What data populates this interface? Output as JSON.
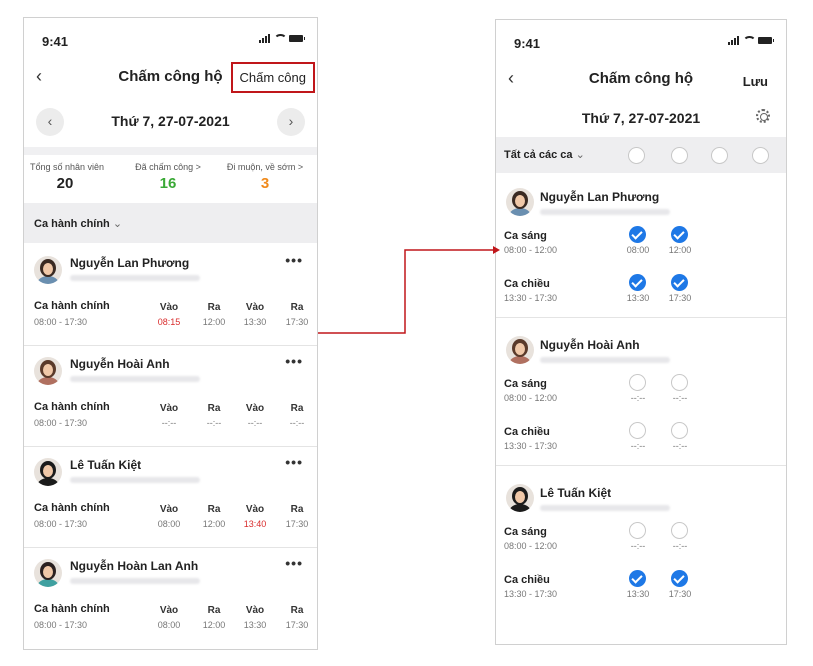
{
  "left": {
    "status_time": "9:41",
    "title": "Chấm công hộ",
    "action_button": "Chấm công",
    "date": "Thứ 7, 27-07-2021",
    "stats": [
      {
        "label": "Tổng số nhân viên",
        "value": "20",
        "color": "#222222"
      },
      {
        "label": "Đã chấm công >",
        "value": "16",
        "color": "#3aa936"
      },
      {
        "label": "Đi muộn, về sớm >",
        "value": "3",
        "color": "#f08a1c"
      }
    ],
    "group_label": "Ca hành chính",
    "employees": [
      {
        "name": "Nguyễn Lan Phương",
        "shift": "Ca hành chính",
        "time": "08:00 - 17:30",
        "cols": [
          {
            "h": "Vào",
            "v": "08:15",
            "late": true
          },
          {
            "h": "Ra",
            "v": "12:00"
          },
          {
            "h": "Vào",
            "v": "13:30"
          },
          {
            "h": "Ra",
            "v": "17:30"
          }
        ]
      },
      {
        "name": "Nguyễn Hoài Anh",
        "shift": "Ca hành chính",
        "time": "08:00 - 17:30",
        "cols": [
          {
            "h": "Vào",
            "v": "--:--"
          },
          {
            "h": "Ra",
            "v": "--:--"
          },
          {
            "h": "Vào",
            "v": "--:--"
          },
          {
            "h": "Ra",
            "v": "--:--"
          }
        ]
      },
      {
        "name": "Lê Tuấn Kiệt",
        "shift": "Ca hành chính",
        "time": "08:00 - 17:30",
        "cols": [
          {
            "h": "Vào",
            "v": "08:00"
          },
          {
            "h": "Ra",
            "v": "12:00"
          },
          {
            "h": "Vào",
            "v": "13:40",
            "late": true
          },
          {
            "h": "Ra",
            "v": "17:30"
          }
        ]
      },
      {
        "name": "Nguyễn Hoàn Lan Anh",
        "shift": "Ca hành chính",
        "time": "08:00 - 17:30",
        "cols": [
          {
            "h": "Vào",
            "v": "08:00"
          },
          {
            "h": "Ra",
            "v": "12:00"
          },
          {
            "h": "Vào",
            "v": "13:30"
          },
          {
            "h": "Ra",
            "v": "17:30"
          }
        ]
      }
    ]
  },
  "right": {
    "status_time": "9:41",
    "title": "Chấm công hộ",
    "save_button": "Lưu",
    "date": "Thứ 7, 27-07-2021",
    "filter_label": "Tất cả các ca",
    "employees": [
      {
        "name": "Nguyễn Lan Phương",
        "shifts": [
          {
            "name": "Ca sáng",
            "time": "08:00 - 12:00",
            "checks": [
              {
                "on": true,
                "t": "08:00"
              },
              {
                "on": true,
                "t": "12:00"
              }
            ]
          },
          {
            "name": "Ca chiều",
            "time": "13:30 - 17:30",
            "checks": [
              {
                "on": true,
                "t": "13:30"
              },
              {
                "on": true,
                "t": "17:30"
              }
            ]
          }
        ]
      },
      {
        "name": "Nguyễn Hoài Anh",
        "shifts": [
          {
            "name": "Ca sáng",
            "time": "08:00 - 12:00",
            "checks": [
              {
                "on": false,
                "t": "--:--"
              },
              {
                "on": false,
                "t": "--:--"
              }
            ]
          },
          {
            "name": "Ca chiều",
            "time": "13:30 - 17:30",
            "checks": [
              {
                "on": false,
                "t": "--:--"
              },
              {
                "on": false,
                "t": "--:--"
              }
            ]
          }
        ]
      },
      {
        "name": "Lê Tuấn Kiệt",
        "shifts": [
          {
            "name": "Ca sáng",
            "time": "08:00 - 12:00",
            "checks": [
              {
                "on": false,
                "t": "--:--"
              },
              {
                "on": false,
                "t": "--:--"
              }
            ]
          },
          {
            "name": "Ca chiều",
            "time": "13:30 - 17:30",
            "checks": [
              {
                "on": true,
                "t": "13:30"
              },
              {
                "on": true,
                "t": "17:30"
              }
            ]
          }
        ]
      }
    ]
  },
  "colors": {
    "accent": "#1e78e6",
    "late": "#d92c2c",
    "highlight": "#c0161a"
  }
}
